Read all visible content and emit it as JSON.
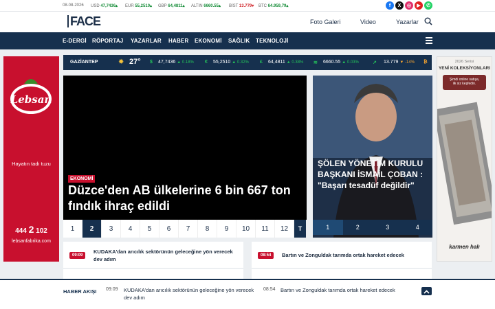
{
  "topbar": {
    "date": "08-08-2026",
    "rates": [
      {
        "label": "USD",
        "value": "47,7436",
        "dir": "up"
      },
      {
        "label": "EUR",
        "value": "55,2510",
        "dir": "up"
      },
      {
        "label": "GBP",
        "value": "64,4811",
        "dir": "up"
      },
      {
        "label": "ALTIN",
        "value": "6660.55",
        "dir": "up"
      },
      {
        "label": "BİST",
        "value": "13.779",
        "dir": "down"
      },
      {
        "label": "BTC",
        "value": "64.959,79",
        "dir": "up"
      }
    ],
    "social": [
      {
        "name": "facebook-icon",
        "glyph": "f",
        "color": "#1877f2"
      },
      {
        "name": "x-icon",
        "glyph": "X",
        "color": "#111111"
      },
      {
        "name": "instagram-icon",
        "glyph": "◎",
        "color": "#e1306c"
      },
      {
        "name": "youtube-icon",
        "glyph": "▶",
        "color": "#e02020"
      },
      {
        "name": "whatsapp-icon",
        "glyph": "✆",
        "color": "#25d366"
      }
    ]
  },
  "header": {
    "logo": "FACE",
    "links": [
      "Foto Galeri",
      "Video",
      "Yazarlar"
    ]
  },
  "nav": {
    "items": [
      "E-DERGİ",
      "RÖPORTAJ",
      "YAZARLAR",
      "HABER",
      "EKONOMİ",
      "SAĞLIK",
      "TEKNOLOJİ"
    ]
  },
  "ticker": {
    "city": "GAZİANTEP",
    "temp": "27°",
    "items": [
      {
        "value": "47,7436",
        "change": "▲ 0.18%",
        "trend": "up"
      },
      {
        "value": "55,2510",
        "change": "▲ 0.32%",
        "trend": "up"
      },
      {
        "value": "64,4811",
        "change": "▲ 0.38%",
        "trend": "up"
      },
      {
        "value": "6660.55",
        "change": "▲ 0.03%",
        "trend": "up"
      },
      {
        "value": "13.779",
        "change": "▼ -14%",
        "trend": "down"
      }
    ]
  },
  "ads": {
    "left": {
      "brand": "Lebsan",
      "slogan": "Hayatın tadı tuzu",
      "phone_prefix": "444",
      "phone_mid": "2",
      "phone_suffix": "102",
      "site": "lebsanfabrika.com"
    },
    "right": {
      "series": "2026 Serisi",
      "headline": "YENİ KOLEKSİYONLARI",
      "cta_line1": "Şimdi online satışa,",
      "cta_line2": "ilk siz keşfedin.",
      "brand": "karmen halı"
    }
  },
  "hero": {
    "category": "EKONOMİ",
    "title": "Düzce'den AB ülkelerine 6 bin 667 ton fındık ihraç edildi",
    "pages": [
      "1",
      "2",
      "3",
      "4",
      "5",
      "6",
      "7",
      "8",
      "9",
      "10",
      "11",
      "12"
    ],
    "active_page": 2,
    "last_label": "T"
  },
  "side": {
    "title": "ŞÖLEN YÖNETİM KURULU BAŞKANI İSMAİL ÇOBAN : \"Başarı tesadüf değildir\"",
    "pages": [
      "1",
      "2",
      "3",
      "4"
    ],
    "active_page": 1
  },
  "news": [
    {
      "time": "09:09",
      "text": "KUDAKA'dan arıcılık sektörünün geleceğine yön verecek dev adım"
    },
    {
      "time": "08:54",
      "text": "Bartın ve Zonguldak tarımda ortak hareket edecek"
    }
  ],
  "footer": {
    "label": "HABER AKIŞI",
    "items": [
      {
        "time": "09:09",
        "text": "KUDAKA'dan arıcılık sektörünün geleceğine yön verecek dev adım"
      },
      {
        "time": "08:54",
        "text": "Bartın ve Zonguldak tarımda ortak hareket edecek"
      }
    ]
  },
  "colors": {
    "brand": "#16304e",
    "accent": "#c8102e",
    "up": "#1a8f3c",
    "down": "#d0262b"
  }
}
